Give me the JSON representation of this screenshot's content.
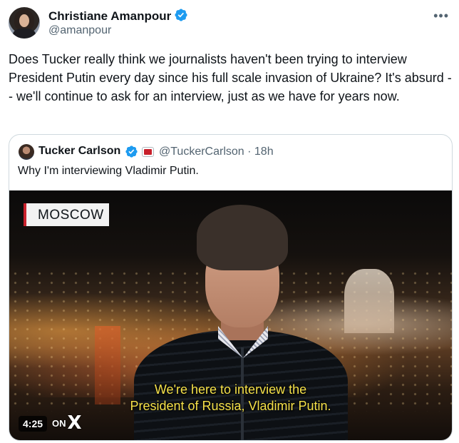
{
  "author": {
    "name": "Christiane Amanpour",
    "handle": "@amanpour",
    "avatar_icon": "profile-photo",
    "verified_icon": "verified-badge-icon"
  },
  "tweet": {
    "text": "Does Tucker really think we journalists haven't been trying to interview President Putin every day since his full scale invasion of Ukraine? It's absurd -- we'll continue to ask for an interview, just as we have for years now.",
    "more_icon": "more-options-icon"
  },
  "quote": {
    "author_name": "Tucker Carlson",
    "handle_time": "@TuckerCarlson · 18h",
    "text": "Why I'm interviewing Vladimir Putin.",
    "affiliate_badge_icon": "affiliate-badge-icon"
  },
  "video": {
    "location": "MOSCOW",
    "subtitle_line1": "We're here to interview the",
    "subtitle_line2": "President of Russia, Vladimir Putin.",
    "duration": "4:25",
    "on_label": "ON",
    "platform_logo": "X"
  },
  "colors": {
    "text_primary": "#0f1419",
    "text_secondary": "#536471",
    "verified_blue": "#1d9bf0",
    "border": "#cfd9de",
    "subtitle_yellow": "#f5e14a",
    "tag_red": "#c8202b"
  }
}
